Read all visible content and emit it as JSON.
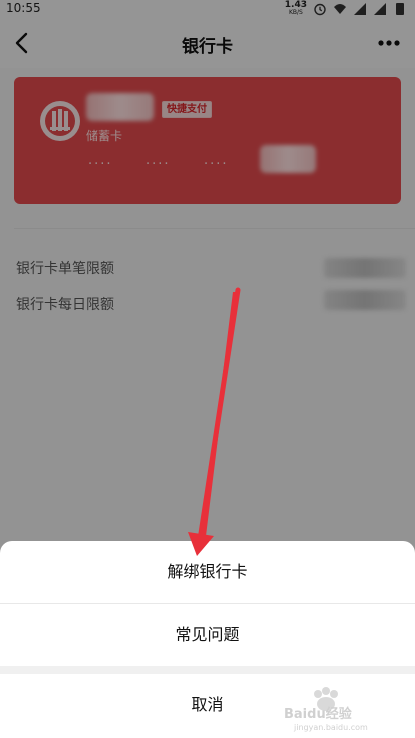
{
  "status_bar": {
    "time": "10:55",
    "net_speed": "1.43",
    "net_unit": "KB/S"
  },
  "nav": {
    "title": "银行卡",
    "back_icon": "chevron-left-icon",
    "more_icon": "more-horizontal-icon"
  },
  "card": {
    "badge": "快捷支付",
    "card_type": "储蓄卡",
    "number_groups": [
      "····",
      "····",
      "····"
    ],
    "color": "#e04a4d"
  },
  "limits": {
    "single_label": "银行卡单笔限额",
    "daily_label": "银行卡每日限额"
  },
  "sheet": {
    "unbind": "解绑银行卡",
    "faq": "常见问题",
    "cancel": "取消"
  },
  "watermark": {
    "brand": "Baidu经验",
    "url": "jingyan.baidu.com"
  }
}
